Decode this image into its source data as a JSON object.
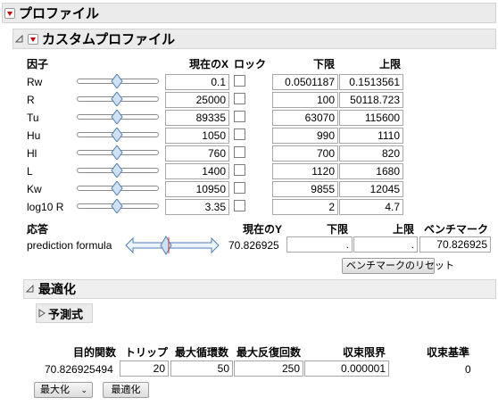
{
  "profiler": {
    "title": "プロファイル"
  },
  "custom": {
    "title": "カスタムプロファイル"
  },
  "factors": {
    "headers": {
      "factor": "因子",
      "current_x": "現在のX",
      "lock": "ロック",
      "lower": "下限",
      "upper": "上限"
    },
    "rows": [
      {
        "name": "Rw",
        "x": "0.1",
        "lower": "0.0501187",
        "upper": "0.1513561"
      },
      {
        "name": "R",
        "x": "25000",
        "lower": "100",
        "upper": "50118.723"
      },
      {
        "name": "Tu",
        "x": "89335",
        "lower": "63070",
        "upper": "115600"
      },
      {
        "name": "Hu",
        "x": "1050",
        "lower": "990",
        "upper": "1110"
      },
      {
        "name": "Hl",
        "x": "760",
        "lower": "700",
        "upper": "820"
      },
      {
        "name": "L",
        "x": "1400",
        "lower": "1120",
        "upper": "1680"
      },
      {
        "name": "Kw",
        "x": "10950",
        "lower": "9855",
        "upper": "12045"
      },
      {
        "name": "log10 R",
        "x": "3.35",
        "lower": "2",
        "upper": "4.7"
      }
    ]
  },
  "response": {
    "headers": {
      "response": "応答",
      "current_y": "現在のY",
      "lower": "下限",
      "upper": "上限",
      "benchmark": "ベンチマーク"
    },
    "name": "prediction formula",
    "current_y": "70.826925",
    "lower": ".",
    "upper": ".",
    "benchmark": "70.826925",
    "reset_button": "ベンチマークのリセット"
  },
  "optimize": {
    "title": "最適化",
    "predict_title": "予測式",
    "headers": {
      "objective": "目的関数",
      "trip": "トリップ",
      "max_cycles": "最大循環数",
      "max_iter": "最大反復回数",
      "conv_limit": "収束限界",
      "conv_crit": "収束基準"
    },
    "values": {
      "objective": "70.826925494",
      "trip": "20",
      "max_cycles": "50",
      "max_iter": "250",
      "conv_limit": "0.000001",
      "conv_crit": "0"
    },
    "mode_select": "最大化",
    "optimize_button": "最適化"
  },
  "colors": {
    "menu_red": "#d20000",
    "header_bg": "#ebebeb",
    "thumb_fill": "#cfe0f3",
    "thumb_stroke": "#4f7fb5"
  }
}
